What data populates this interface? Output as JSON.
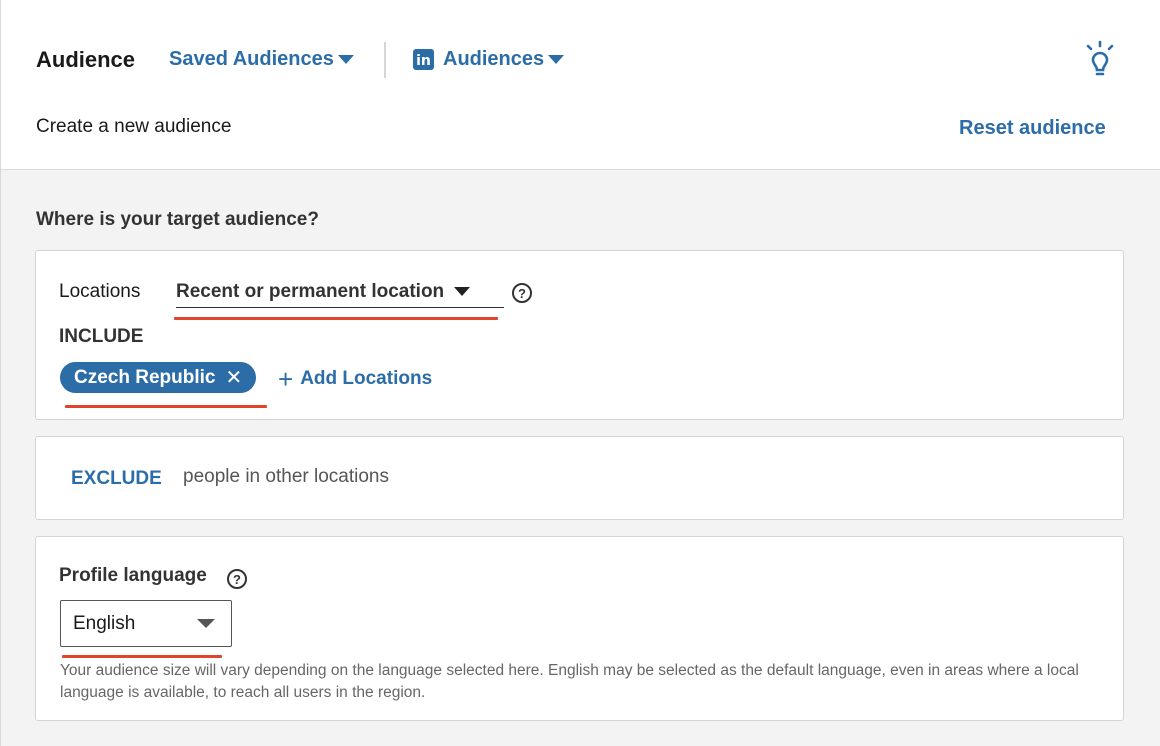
{
  "header": {
    "title": "Audience",
    "saved_audiences": "Saved Audiences",
    "audiences": "Audiences",
    "linkedin_logo": "in",
    "subtitle": "Create a new audience",
    "reset": "Reset audience"
  },
  "section": {
    "question": "Where is your target audience?"
  },
  "locations": {
    "label": "Locations",
    "selected_type": "Recent or permanent location",
    "help": "?",
    "include_label": "INCLUDE",
    "included": [
      {
        "name": "Czech Republic",
        "remove_glyph": "✕"
      }
    ],
    "add_button": "Add Locations",
    "add_glyph": "+"
  },
  "exclude": {
    "button": "EXCLUDE",
    "text": "people in other locations"
  },
  "profile_language": {
    "label": "Profile language",
    "help": "?",
    "selected": "English",
    "note": "Your audience size will vary depending on the language selected here. English may be selected as the default language, even in areas where a local language is available, to reach all users in the region."
  },
  "colors": {
    "link_blue": "#2c6da8",
    "annotation_red": "#e0442b",
    "panel_bg": "#f3f3f3"
  },
  "icons": [
    "caret-down-icon",
    "linkedin-icon",
    "lightbulb-icon",
    "help-icon",
    "close-icon",
    "plus-icon"
  ]
}
